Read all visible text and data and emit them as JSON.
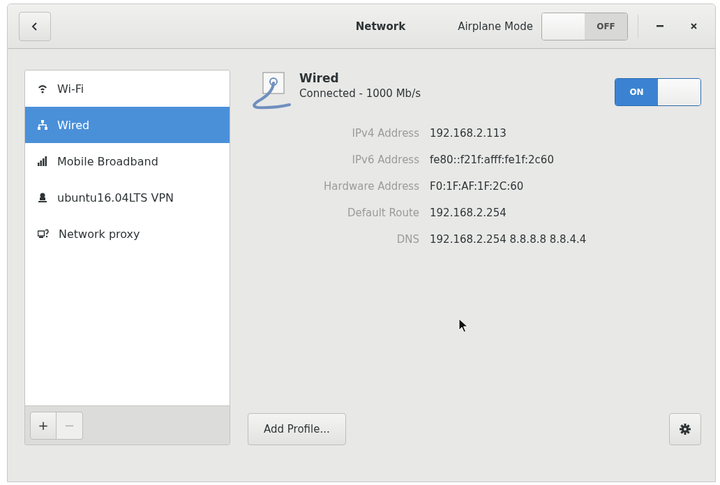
{
  "window": {
    "title": "Network"
  },
  "airplane_mode": {
    "label": "Airplane Mode",
    "on": false,
    "state_text": "OFF"
  },
  "sidebar": {
    "items": [
      {
        "label": "Wi-Fi",
        "kind": "wifi",
        "selected": false
      },
      {
        "label": "Wired",
        "kind": "wired",
        "selected": true
      },
      {
        "label": "Mobile Broadband",
        "kind": "mobile",
        "selected": false
      },
      {
        "label": "ubuntu16.04LTS VPN",
        "kind": "vpn",
        "selected": false
      },
      {
        "label": "Network proxy",
        "kind": "proxy",
        "selected": false
      }
    ],
    "add_button": {
      "text": "+",
      "disabled": false
    },
    "remove_button": {
      "text": "−",
      "disabled": true
    }
  },
  "device": {
    "title": "Wired",
    "status": "Connected - 1000 Mb/s",
    "switch": {
      "on": true,
      "state_text": "ON"
    },
    "details": [
      {
        "label": "IPv4 Address",
        "value": "192.168.2.113"
      },
      {
        "label": "IPv6 Address",
        "value": "fe80::f21f:afff:fe1f:2c60"
      },
      {
        "label": "Hardware Address",
        "value": "F0:1F:AF:1F:2C:60"
      },
      {
        "label": "Default Route",
        "value": "192.168.2.254"
      },
      {
        "label": "DNS",
        "value": "192.168.2.254 8.8.8.8 8.8.4.4"
      }
    ],
    "add_profile_button": "Add Profile..."
  }
}
